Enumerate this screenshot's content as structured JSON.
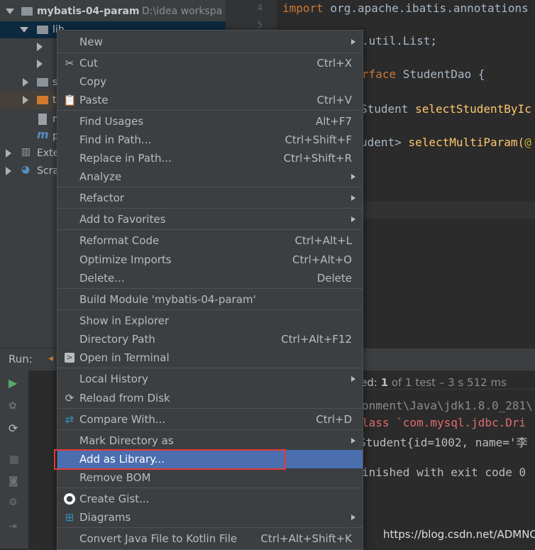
{
  "project": {
    "root_name": "mybatis-04-param",
    "root_path": "D:\\idea workspa",
    "lib": "lib",
    "partial_s": "s",
    "partial_t": "t",
    "partial_m": "m",
    "partial_p": "p",
    "external": "Exte",
    "scratches": "Scra"
  },
  "gutter": {
    "line4": "4",
    "line5": "5"
  },
  "editor": {
    "line1_kw": "import",
    "line1_rest": " org.apache.ibatis.annotations",
    "line2": ".util.List;",
    "line3_kw": "rface",
    "line3_rest": " StudentDao {",
    "line4_type": "Student ",
    "line4_fn": "selectStudentByIc",
    "line5_type": "udent> ",
    "line5_fn": "selectMultiParam(",
    "line5_at": "@",
    "line6_at": "@"
  },
  "run": {
    "label": "Run:",
    "status_prefix": "ed: ",
    "status_count": "1",
    "status_rest": " of 1 test – 3 s 512 ms",
    "out1": "onment\\Java\\jdk1.8.0_281\\",
    "out2_kw": "lass",
    "out2_rest": " `com.mysql.jdbc.Dri",
    "out3": "Student{id=1002, name='李",
    "out4": "inished with exit code 0"
  },
  "menu": {
    "new": "New",
    "cut": "Cut",
    "cut_sc": "Ctrl+X",
    "copy": "Copy",
    "paste": "Paste",
    "paste_sc": "Ctrl+V",
    "find_usages": "Find Usages",
    "find_usages_sc": "Alt+F7",
    "find_in_path": "Find in Path...",
    "find_in_path_sc": "Ctrl+Shift+F",
    "replace_in_path": "Replace in Path...",
    "replace_in_path_sc": "Ctrl+Shift+R",
    "analyze": "Analyze",
    "refactor": "Refactor",
    "add_to_favorites": "Add to Favorites",
    "reformat": "Reformat Code",
    "reformat_sc": "Ctrl+Alt+L",
    "optimize": "Optimize Imports",
    "optimize_sc": "Ctrl+Alt+O",
    "delete": "Delete...",
    "delete_sc": "Delete",
    "build_module": "Build Module 'mybatis-04-param'",
    "show_explorer": "Show in Explorer",
    "directory_path": "Directory Path",
    "directory_path_sc": "Ctrl+Alt+F12",
    "open_terminal": "Open in Terminal",
    "local_history": "Local History",
    "reload_disk": "Reload from Disk",
    "compare_with": "Compare With...",
    "compare_with_sc": "Ctrl+D",
    "mark_directory": "Mark Directory as",
    "add_library": "Add as Library...",
    "remove_bom": "Remove BOM",
    "create_gist": "Create Gist...",
    "diagrams": "Diagrams",
    "convert_kotlin": "Convert Java File to Kotlin File",
    "convert_kotlin_sc": "Ctrl+Alt+Shift+K"
  },
  "watermark": "https://blog.csdn.net/ADMNC",
  "colors": {
    "selection": "#4b6eaf",
    "highlight_box": "#e33a3a"
  }
}
